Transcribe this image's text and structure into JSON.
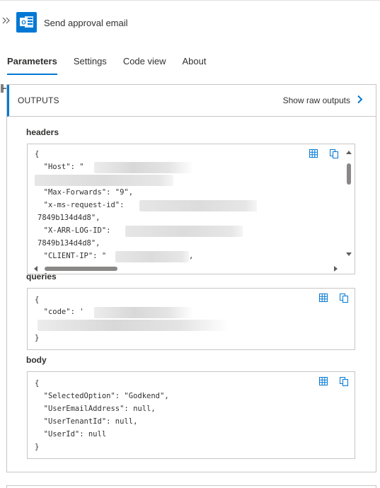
{
  "header": {
    "title": "Send approval email",
    "expand_icon": "double-chevron-right-icon",
    "app_icon": "outlook-icon",
    "accent": "#0078d4"
  },
  "tabs": [
    {
      "label": "Parameters",
      "active": true
    },
    {
      "label": "Settings",
      "active": false
    },
    {
      "label": "Code view",
      "active": false
    },
    {
      "label": "About",
      "active": false
    }
  ],
  "outputs": {
    "label": "OUTPUTS",
    "raw_link": "Show raw outputs",
    "raw_icon": "chevron-right-icon"
  },
  "headers": {
    "label": "headers",
    "lines": [
      "{",
      "  \"Host\": \"",
      "",
      "  \"Max-Forwards\": \"9\",",
      "  \"x-ms-request-id\":",
      "7849b134d4d8\",",
      "  \"X-ARR-LOG-ID\":",
      "7849b134d4d8\",",
      "  \"CLIENT-IP\": \"",
      ","
    ]
  },
  "queries": {
    "label": "queries",
    "lines": [
      "{",
      "  \"code\": '",
      "",
      "}"
    ]
  },
  "body": {
    "label": "body",
    "lines": [
      "{",
      "  \"SelectedOption\": \"Godkend\",",
      "  \"UserEmailAddress\": null,",
      "  \"UserTenantId\": null,",
      "  \"UserId\": null",
      "}"
    ]
  },
  "box_icons": [
    "table-view-icon",
    "copy-icon"
  ]
}
